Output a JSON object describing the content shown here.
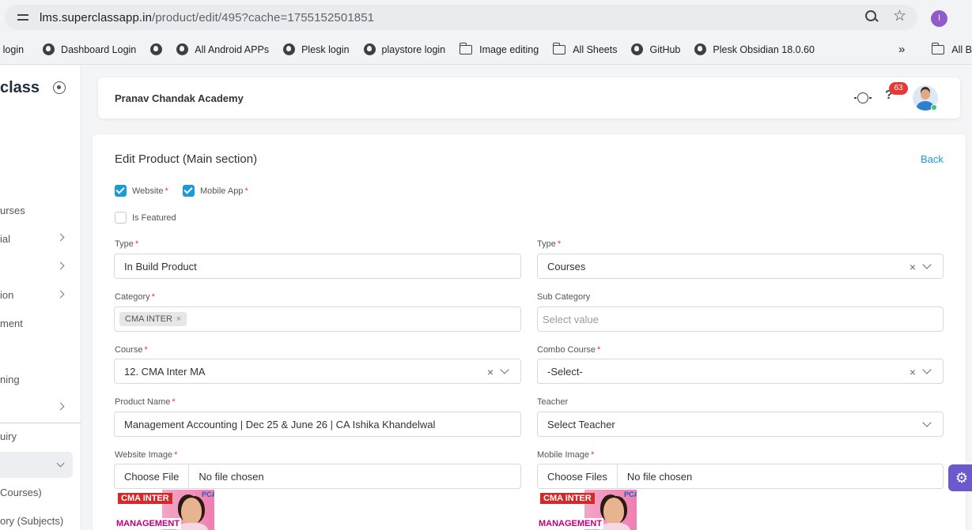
{
  "browser": {
    "url_host": "lms.superclassapp.in",
    "url_path": "/product/edit/495?cache=1755152501851",
    "profile_initial": "I",
    "bookmarks": [
      {
        "label": "r login",
        "icon": "globe-icon"
      },
      {
        "label": "Dashboard Login",
        "icon": "globe-icon"
      },
      {
        "label": "",
        "icon": "globe-icon"
      },
      {
        "label": "All Android APPs",
        "icon": "globe-icon"
      },
      {
        "label": "Plesk login",
        "icon": "globe-icon"
      },
      {
        "label": "playstore login",
        "icon": "globe-icon"
      },
      {
        "label": "Image editing",
        "icon": "folder-icon"
      },
      {
        "label": "All Sheets",
        "icon": "folder-icon"
      },
      {
        "label": "GitHub",
        "icon": "globe-icon"
      },
      {
        "label": "Plesk Obsidian 18.0.60",
        "icon": "globe-icon"
      }
    ],
    "bookmarks_more": "»",
    "all_bookmarks": "All Bookmarks"
  },
  "sidebar": {
    "logo": "class",
    "items": [
      {
        "label": "urses"
      },
      {
        "label": "ial"
      },
      {
        "label": ""
      },
      {
        "label": "ion"
      },
      {
        "label": "ment"
      },
      {
        "label": "ning"
      },
      {
        "label": ""
      },
      {
        "label": "uiry"
      },
      {
        "label": ""
      },
      {
        "label": "Courses)"
      },
      {
        "label": "ory (Subjects)"
      }
    ]
  },
  "header": {
    "academy": "Pranav Chandak Academy",
    "notification_count": "63"
  },
  "form": {
    "title": "Edit Product (Main section)",
    "back": "Back",
    "website_label": "Website",
    "mobile_label": "Mobile App",
    "featured_label": "Is Featured",
    "type_label": "Type",
    "type_value": "In Build Product",
    "type2_label": "Type",
    "type2_value": "Courses",
    "category_label": "Category",
    "category_chip": "CMA INTER",
    "subcategory_label": "Sub Category",
    "subcategory_placeholder": "Select value",
    "course_label": "Course",
    "course_value": "12. CMA Inter MA",
    "combo_label": "Combo Course",
    "combo_value": "-Select-",
    "product_name_label": "Product Name",
    "product_name_value": "Management Accounting | Dec 25 & June 26 | CA Ishika Khandelwal",
    "teacher_label": "Teacher",
    "teacher_value": "Select Teacher",
    "website_image_label": "Website Image",
    "website_file_button": "Choose File",
    "website_file_status": "No file chosen",
    "mobile_image_label": "Mobile Image",
    "mobile_file_button": "Choose Files",
    "mobile_file_status": "No file chosen",
    "thumb_tag": "CMA INTER",
    "thumb_title": "MANAGEMENT",
    "thumb_logo": "PCA"
  },
  "colors": {
    "accent": "#1a9bd7",
    "required": "#e53935",
    "settings": "#6a5acd"
  }
}
